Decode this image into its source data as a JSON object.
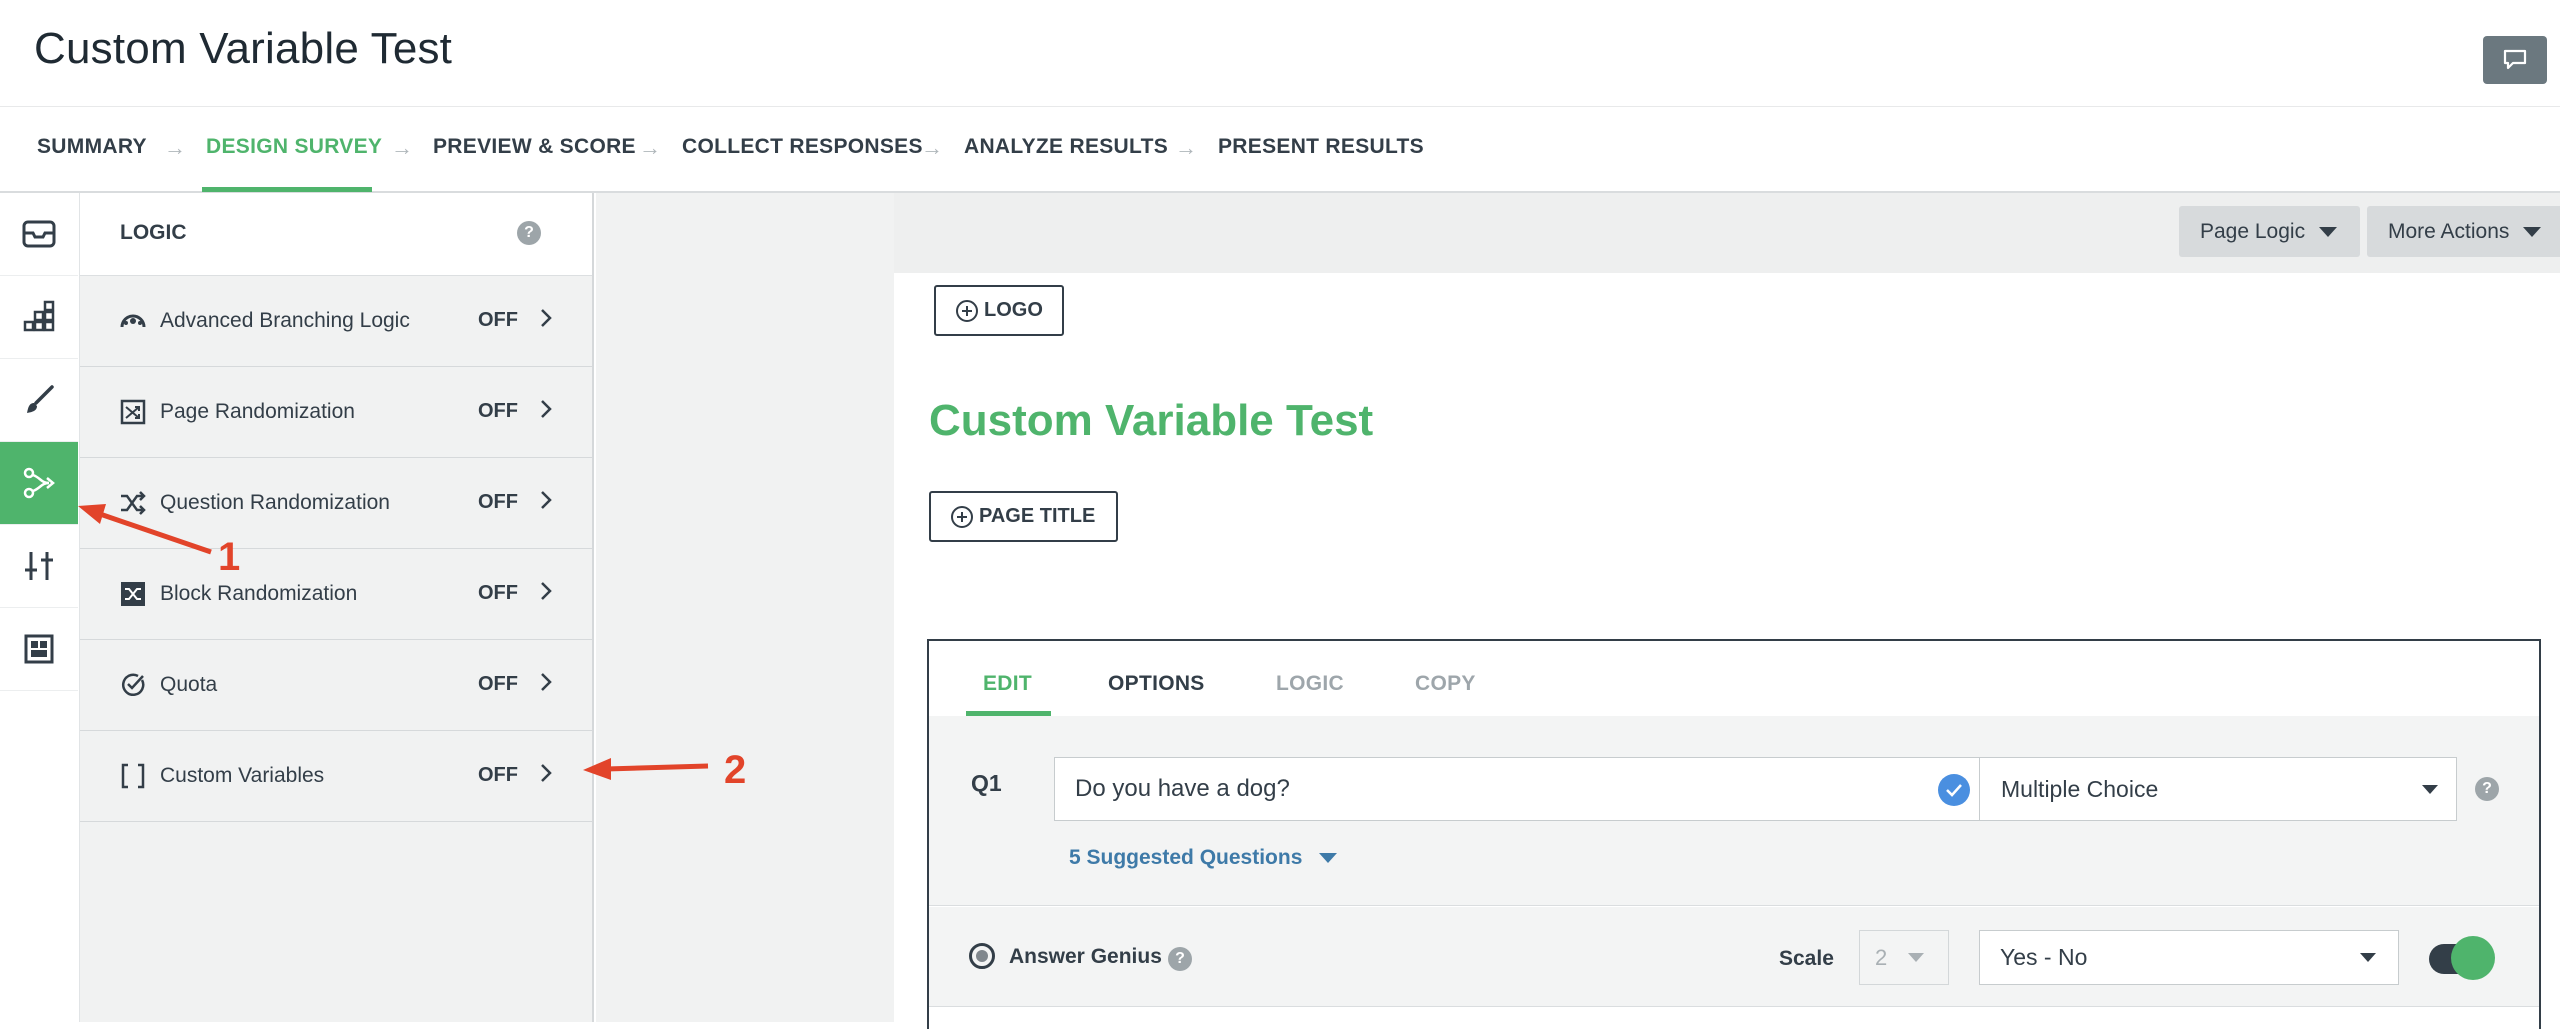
{
  "header": {
    "title": "Custom Variable Test"
  },
  "nav": {
    "summary": "SUMMARY",
    "design": "DESIGN SURVEY",
    "preview": "PREVIEW & SCORE",
    "collect": "COLLECT RESPONSES",
    "analyze": "ANALYZE RESULTS",
    "present": "PRESENT RESULTS",
    "arrow": "→"
  },
  "sidebar_icons": [
    "question-bank-icon",
    "builder-icon",
    "style-brush-icon",
    "logic-icon",
    "options-sliders-icon",
    "layout-grid-icon"
  ],
  "logic_panel": {
    "title": "LOGIC",
    "help": "?",
    "items": [
      {
        "label": "Advanced Branching Logic",
        "state": "OFF",
        "icon": "branching-icon"
      },
      {
        "label": "Page Randomization",
        "state": "OFF",
        "icon": "page-random-icon"
      },
      {
        "label": "Question Randomization",
        "state": "OFF",
        "icon": "shuffle-icon"
      },
      {
        "label": "Block Randomization",
        "state": "OFF",
        "icon": "block-shuffle-icon"
      },
      {
        "label": "Quota",
        "state": "OFF",
        "icon": "check-circle-icon"
      },
      {
        "label": "Custom Variables",
        "state": "OFF",
        "icon": "brackets-icon"
      }
    ]
  },
  "toolbar": {
    "page_logic": "Page Logic",
    "more_actions": "More Actions"
  },
  "survey": {
    "logo_button": "LOGO",
    "title": "Custom Variable Test",
    "page_title_button": "PAGE TITLE"
  },
  "question": {
    "tabs": {
      "edit": "EDIT",
      "options": "OPTIONS",
      "logic": "LOGIC",
      "copy": "COPY"
    },
    "number": "Q1",
    "text": "Do you have a dog?",
    "type": "Multiple Choice",
    "help": "?",
    "suggested": "5 Suggested Questions",
    "answer_genius": "Answer Genius",
    "scale_label": "Scale",
    "scale_value": "2",
    "answer_set": "Yes - No"
  },
  "annotations": {
    "one": "1",
    "two": "2"
  },
  "colors": {
    "accent": "#4fb46c",
    "annotation": "#e2442a",
    "link": "#3e7aa8",
    "text": "#333e48"
  }
}
